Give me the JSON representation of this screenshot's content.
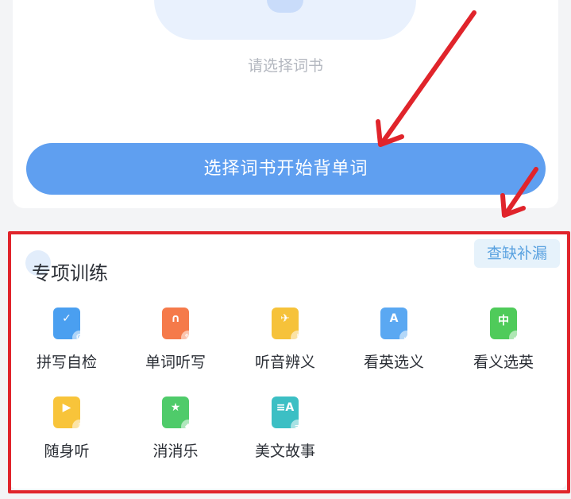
{
  "word_book": {
    "empty_hint": "请选择词书",
    "start_button": "选择词书开始背单词"
  },
  "training": {
    "title": "专项训练",
    "check_button": "查缺补漏",
    "items": [
      {
        "label": "拼写自检",
        "icon": "spelling-check-icon",
        "color": "#4a9ff0"
      },
      {
        "label": "单词听写",
        "icon": "headphones-dictation-icon",
        "color": "#f57a4a"
      },
      {
        "label": "听音辨义",
        "icon": "listen-meaning-icon",
        "color": "#f6c23a"
      },
      {
        "label": "看英选义",
        "icon": "english-to-meaning-icon",
        "color": "#5aa8f2"
      },
      {
        "label": "看义选英",
        "icon": "meaning-to-english-icon",
        "color": "#4fcb5a"
      },
      {
        "label": "随身听",
        "icon": "play-audio-icon",
        "color": "#f8c43a"
      },
      {
        "label": "消消乐",
        "icon": "match-game-icon",
        "color": "#4fcb6a"
      },
      {
        "label": "美文故事",
        "icon": "story-book-icon",
        "color": "#3cbfc4"
      }
    ]
  },
  "annotation_colors": {
    "arrow": "#e0242b",
    "highlight_box": "#e0242b"
  }
}
